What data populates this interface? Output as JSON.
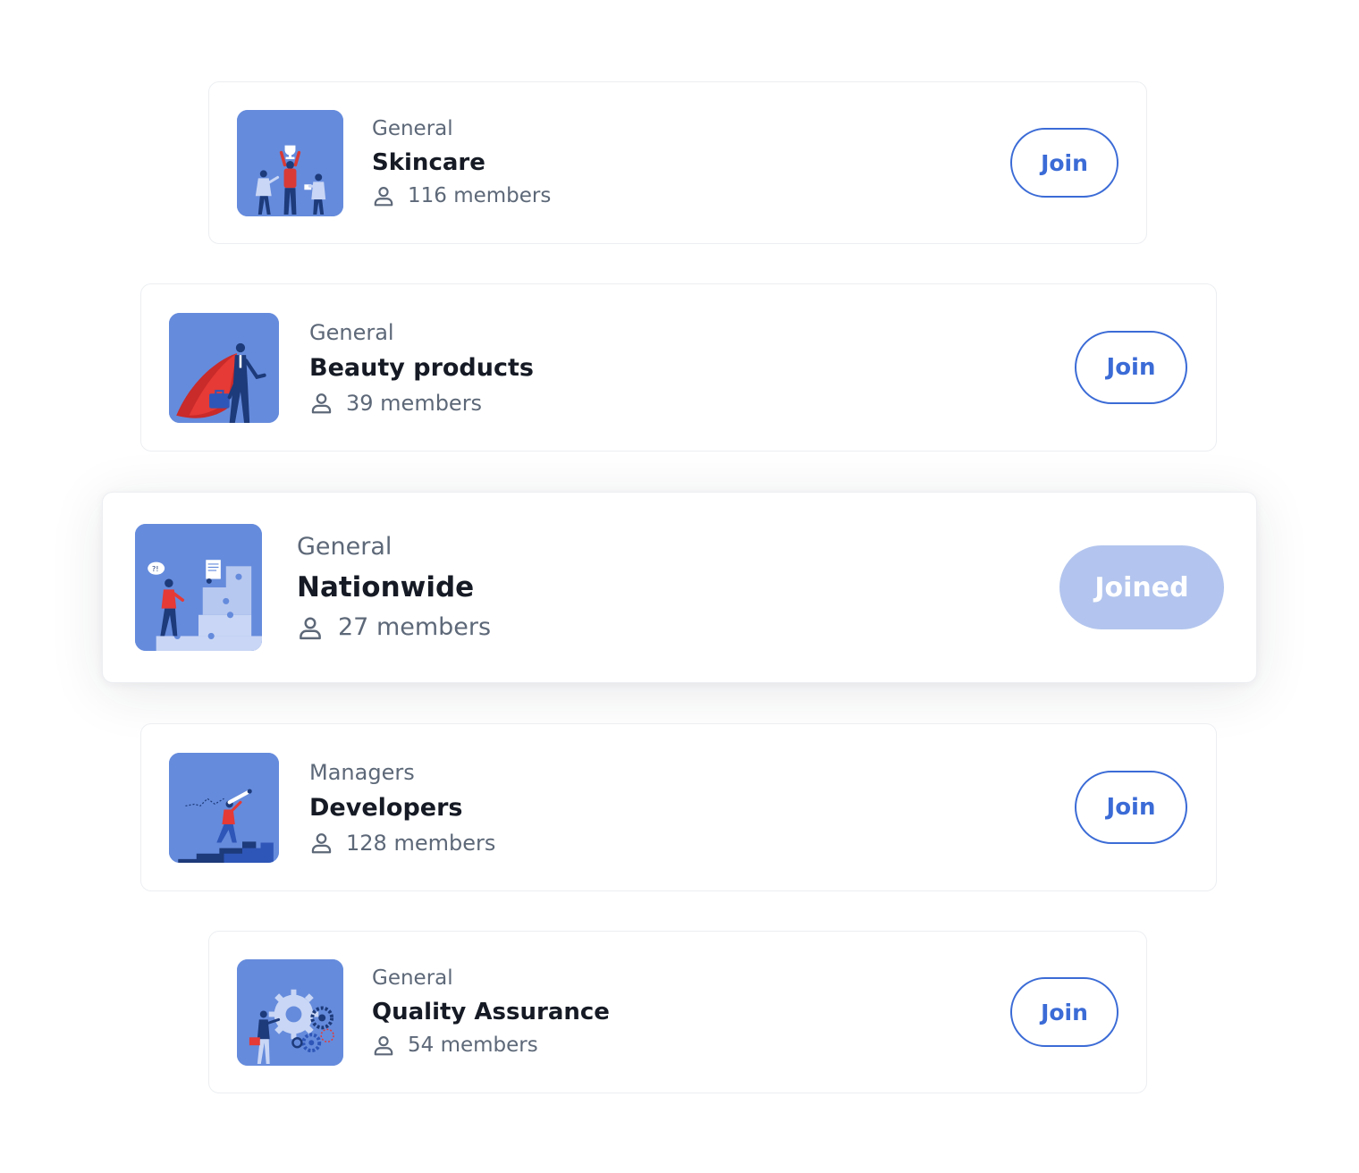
{
  "colors": {
    "thumbnail_bg": "#658bdc",
    "accent": "#3b6bd6",
    "joined_bg": "#b3c5ee",
    "title_text": "#151a24",
    "meta_text": "#5d6878",
    "card_border": "#eceef1"
  },
  "groups": [
    {
      "category": "General",
      "name": "Skincare",
      "members": "116 members",
      "button_label": "Join",
      "joined": false,
      "illustration": "trophy-team-illustration"
    },
    {
      "category": "General",
      "name": "Beauty products",
      "members": "39 members",
      "button_label": "Join",
      "joined": false,
      "illustration": "superhero-businessman-illustration"
    },
    {
      "category": "General",
      "name": "Nationwide",
      "members": "27 members",
      "button_label": "Joined",
      "joined": true,
      "illustration": "puzzle-stairs-illustration"
    },
    {
      "category": "Managers",
      "name": "Developers",
      "members": "128 members",
      "button_label": "Join",
      "joined": false,
      "illustration": "telescope-stairs-illustration"
    },
    {
      "category": "General",
      "name": "Quality Assurance",
      "members": "54 members",
      "button_label": "Join",
      "joined": false,
      "illustration": "gears-inspection-illustration"
    }
  ]
}
